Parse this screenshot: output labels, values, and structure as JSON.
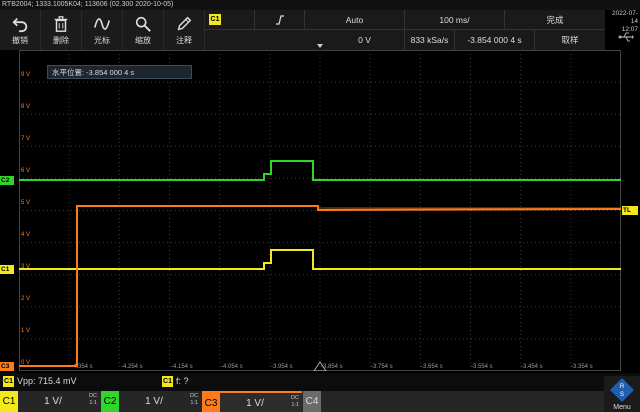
{
  "header": {
    "title": "RTB2004; 1333.1005K04; 113606 (02.300 2020-10-05)"
  },
  "toolbar": {
    "items": [
      {
        "label": "撤销",
        "icon": "undo-icon"
      },
      {
        "label": "删除",
        "icon": "trash-icon"
      },
      {
        "label": "光标",
        "icon": "cursor-wave-icon"
      },
      {
        "label": "缩放",
        "icon": "zoom-icon"
      },
      {
        "label": "注释",
        "icon": "pencil-icon"
      }
    ]
  },
  "trigger": {
    "source": "C1",
    "slope_icon": "rising-edge-icon",
    "mode": "Auto",
    "timebase": "100 ms/",
    "status": "完成",
    "level": "0 V",
    "sample_rate": "833 kSa/s",
    "position": "-3.854 000 4 s",
    "acquire": "取样"
  },
  "datetime": {
    "date": "2022-07-14",
    "time": "12:07"
  },
  "horizontal_position": "水平位置: -3.854 000 4 s",
  "plot": {
    "y_labels": [
      "9 V",
      "8 V",
      "7 V",
      "6 V",
      "5 V",
      "4 V",
      "3 V",
      "2 V",
      "1 V",
      "0 V"
    ],
    "x_labels": [
      "-4.354 s",
      "-4.254 s",
      "-4.154 s",
      "-4.054 s",
      "-3.954 s",
      "-3.854 s",
      "-3.754 s",
      "-3.654 s",
      "-3.554 s",
      "-3.454 s",
      "-3.354 s"
    ],
    "markers": {
      "c2": "C2",
      "c1": "C1",
      "c3": "C3",
      "tl": "TL"
    },
    "colors": {
      "c1": "#f3e81c",
      "c2": "#2fd52b",
      "c3": "#ff7a1a",
      "c4": "#6b6b6b",
      "grid": "#3a3a3a"
    }
  },
  "measurement": {
    "m1_badge": "C1",
    "m1_text": "Vpp: 715.4 mV",
    "m2_badge": "C1",
    "m2_text": "f: ?"
  },
  "channels": [
    {
      "tag": "C1",
      "value": "1 V/",
      "coupling": "DC",
      "bw": "1:1"
    },
    {
      "tag": "C2",
      "value": "1 V/",
      "coupling": "DC",
      "bw": "1:1"
    },
    {
      "tag": "C3",
      "value": "1 V/",
      "coupling": "DC",
      "bw": "1:1"
    },
    {
      "tag": "C4",
      "value": "",
      "coupling": "",
      "bw": ""
    }
  ],
  "menu_label": "Menu"
}
